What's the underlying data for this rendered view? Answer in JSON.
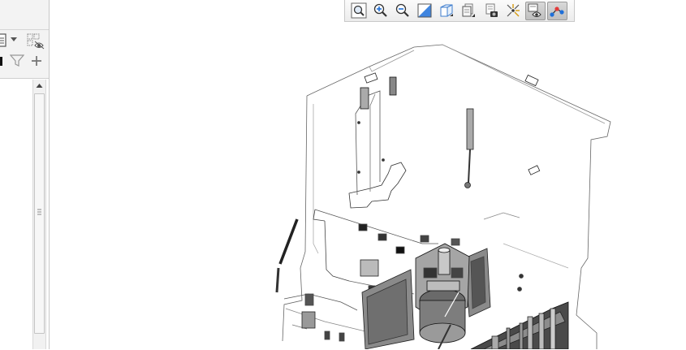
{
  "left_panel": {
    "header_icons": [
      "list-view-icon",
      "dropdown-arrow-icon",
      "hide-items-icon"
    ],
    "filter_row_icons": [
      "pin-icon",
      "filter-icon",
      "add-icon"
    ],
    "scrollbar": {
      "position": 0.0
    }
  },
  "toolbar": {
    "buttons": [
      {
        "name": "zoom-to-fit-button",
        "icon": "zoom-fit-icon",
        "active": false
      },
      {
        "name": "zoom-in-button",
        "icon": "zoom-in-icon",
        "active": false
      },
      {
        "name": "zoom-out-button",
        "icon": "zoom-out-icon",
        "active": false
      },
      {
        "name": "zoom-area-button",
        "icon": "zoom-area-icon",
        "active": false
      },
      {
        "name": "view-cube-button",
        "icon": "cube-view-icon",
        "active": false
      },
      {
        "name": "display-style-button",
        "icon": "display-style-icon",
        "active": false
      },
      {
        "name": "snapshot-button",
        "icon": "camera-icon",
        "active": false
      },
      {
        "name": "explode-button",
        "icon": "explode-icon",
        "active": false
      },
      {
        "name": "show-hide-button",
        "icon": "eye-icon",
        "active": true
      },
      {
        "name": "connections-button",
        "icon": "network-icon",
        "active": true
      }
    ]
  },
  "viewport": {
    "content": "3d-assembly-model",
    "accent": "#1e6fd9"
  }
}
